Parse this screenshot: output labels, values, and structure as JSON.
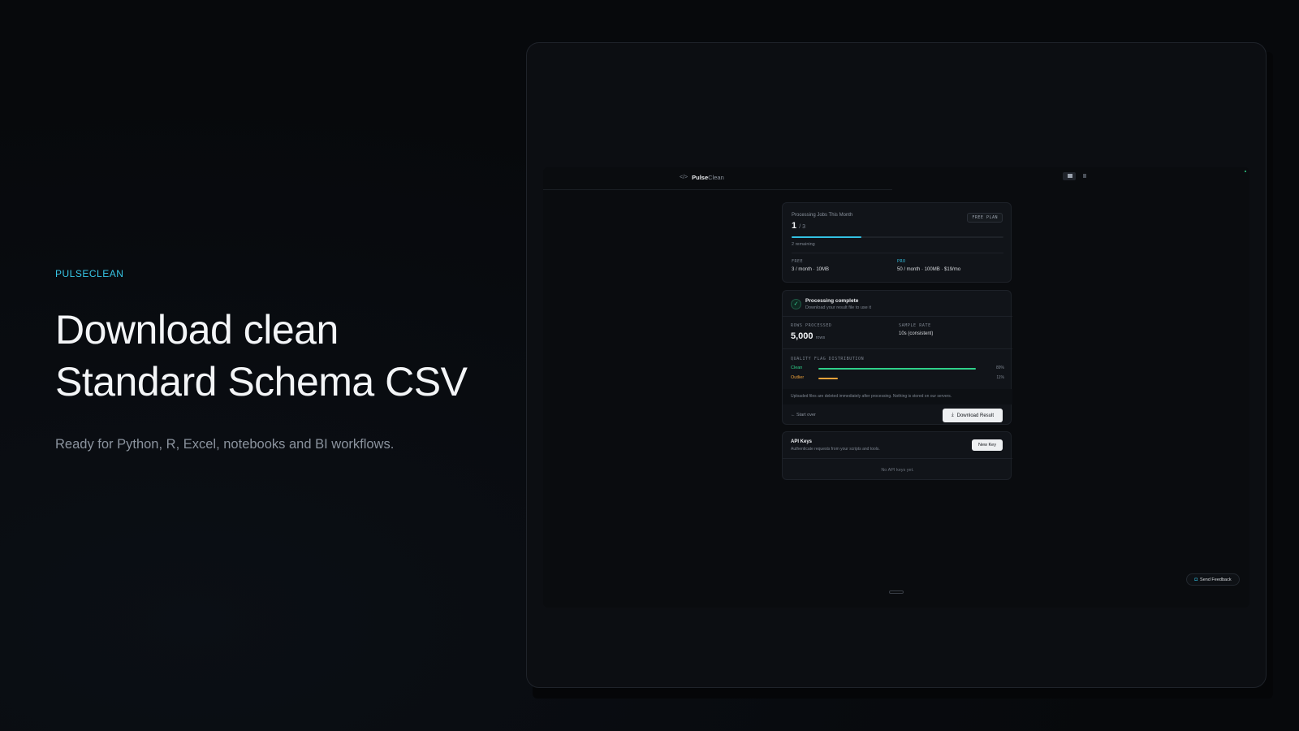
{
  "hero": {
    "eyebrow": "PULSECLEAN",
    "headline_line1": "Download clean",
    "headline_line2": "Standard Schema CSV",
    "subtitle": "Ready for Python, R, Excel, notebooks and BI workflows."
  },
  "app": {
    "brand_icon": "code-icon",
    "brand_bold": "Pulse",
    "brand_light": "Clean",
    "usage": {
      "title": "Processing Jobs This Month",
      "badge": "FREE PLAN",
      "count": "1",
      "limit": "/ 3",
      "progress_fraction": 0.33,
      "remaining": "2 remaining",
      "accent": "#33c2e3",
      "plans": [
        {
          "name": "FREE",
          "detail": "3 / month · 10MB"
        },
        {
          "name": "PRO",
          "detail": "50 / month · 100MB · $19/mo"
        }
      ]
    },
    "result": {
      "check_icon": "check-icon",
      "title": "Processing complete",
      "description": "Download your result file to use it",
      "rows_label": "ROWS PROCESSED",
      "rows_value": "5,000",
      "rows_unit": "rows",
      "rate_label": "SAMPLE RATE",
      "rate_value": "10s (consistent)",
      "distribution_title": "QUALITY FLAG DISTRIBUTION",
      "flags": [
        {
          "name": "Clean",
          "percent_label": "89%",
          "fraction": 0.89,
          "color": "#2fd18a"
        },
        {
          "name": "Outlier",
          "percent_label": "11%",
          "fraction": 0.11,
          "color": "#f2a33a"
        }
      ],
      "notice": "Uploaded files are deleted immediately after processing. Nothing is stored on our servers.",
      "start_over": "← Start over",
      "download_label": "Download Result"
    },
    "api_keys": {
      "title": "API Keys",
      "description": "Authenticate requests from your scripts and tools.",
      "new_key_label": "New Key",
      "empty": "No API keys yet."
    },
    "feedback_label": "Send Feedback"
  }
}
